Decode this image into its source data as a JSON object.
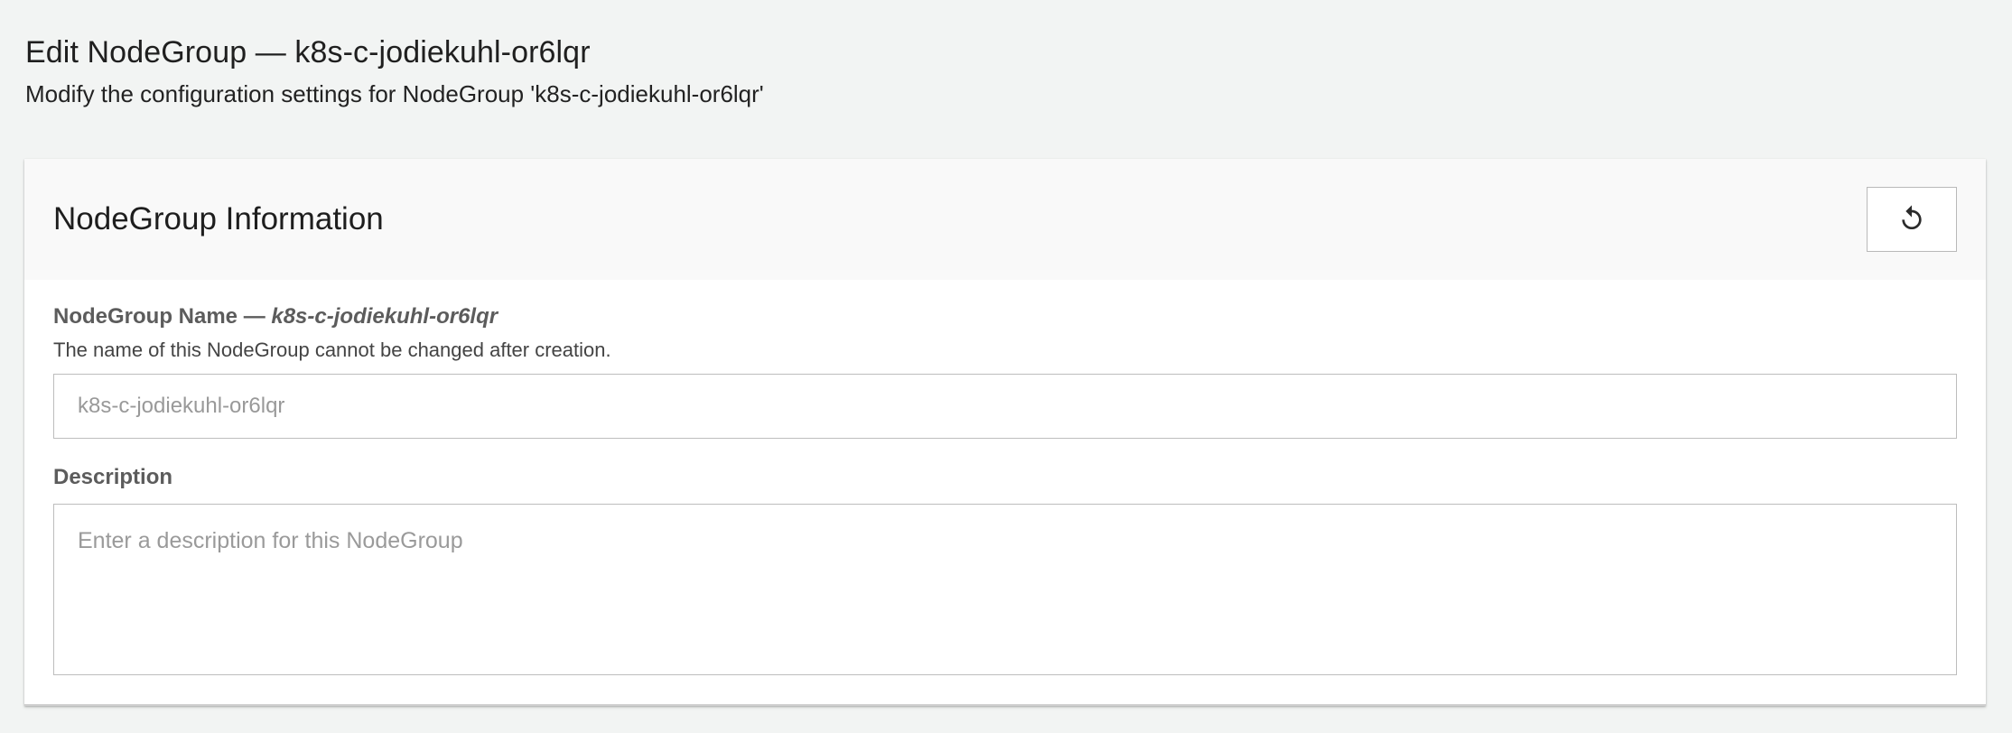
{
  "page": {
    "title": "Edit NodeGroup — k8s-c-jodiekuhl-or6lqr",
    "subtitle": "Modify the configuration settings for NodeGroup 'k8s-c-jodiekuhl-or6lqr'"
  },
  "card": {
    "title": "NodeGroup Information",
    "reset_icon": "reset-icon"
  },
  "fields": {
    "name": {
      "label_prefix": "NodeGroup Name — ",
      "label_value": "k8s-c-jodiekuhl-or6lqr",
      "help": "The name of this NodeGroup cannot be changed after creation.",
      "placeholder": "k8s-c-jodiekuhl-or6lqr",
      "value": ""
    },
    "description": {
      "label": "Description",
      "placeholder": "Enter a description for this NodeGroup",
      "value": ""
    }
  }
}
